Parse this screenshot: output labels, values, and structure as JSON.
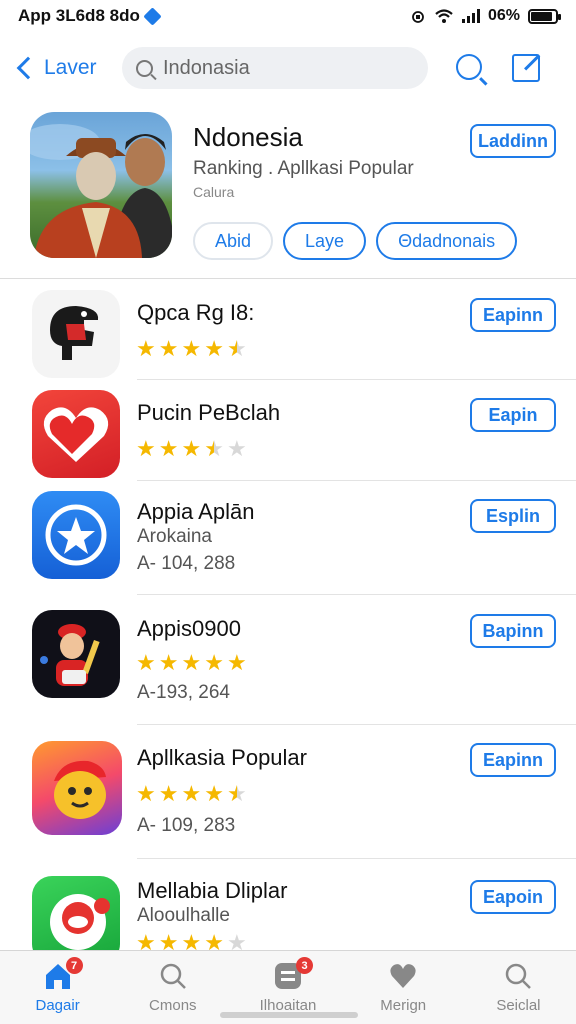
{
  "status": {
    "left_text": "App 3L6d8 8do",
    "battery": "06%"
  },
  "nav": {
    "back_label": "Laver",
    "search_value": "Indonasia"
  },
  "featured": {
    "title": "Ndonesia",
    "subtitle": "Ranking . Apllkasi Popular",
    "category": "Calura",
    "get_label": "Laddinn",
    "chips": [
      "Abid",
      "Laye",
      "Θdadnonais"
    ]
  },
  "rows": [
    {
      "title": "Qpca Rg I8:",
      "subtitle": "",
      "count": "",
      "rating": 4.5,
      "get_label": "Eapinn"
    },
    {
      "title": "Pucin PeBclah",
      "subtitle": "",
      "count": "",
      "rating": 3.5,
      "get_label": "Eapin"
    },
    {
      "title": "Appia Aplān",
      "subtitle": "Arokaina",
      "count": "A- 104, 288",
      "rating": null,
      "get_label": "Esplin"
    },
    {
      "title": "Appis0900",
      "subtitle": "",
      "count": "A-193, 264",
      "rating": 5,
      "get_label": "Bapinn"
    },
    {
      "title": "Apllkasia Popular",
      "subtitle": "",
      "count": "A- 109, 283",
      "rating": 4.5,
      "get_label": "Eapinn"
    },
    {
      "title": "Mellabia Dliplar",
      "subtitle": "Alooulhalle",
      "count": "",
      "rating": 4.5,
      "get_label": "Eapoin"
    }
  ],
  "tabs": [
    {
      "label": "Dagair",
      "badge": "7",
      "icon": "home-icon",
      "active": true
    },
    {
      "label": "Cmons",
      "badge": "",
      "icon": "search-icon",
      "active": false
    },
    {
      "label": "Ilhoaitan",
      "badge": "3",
      "icon": "apps-icon",
      "active": false
    },
    {
      "label": "Merign",
      "badge": "",
      "icon": "heart-icon",
      "active": false
    },
    {
      "label": "Seiclal",
      "badge": "",
      "icon": "search-icon",
      "active": false
    }
  ],
  "colors": {
    "accent": "#1e7be8",
    "star": "#f5b800",
    "badge": "#e53935"
  }
}
